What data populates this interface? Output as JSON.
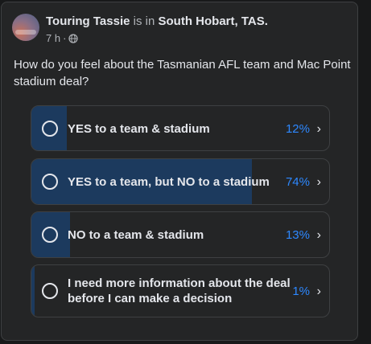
{
  "post": {
    "author": "Touring Tassie",
    "connector": "is in",
    "location": "South Hobart, TAS.",
    "time": "7 h",
    "separator": "·",
    "privacy_icon": "globe-icon",
    "question": "How do you feel about the Tasmanian AFL team and Mac Point stadium deal?"
  },
  "poll": {
    "accent_color": "#2d88ff",
    "fill_color": "#1c3a5e",
    "options": [
      {
        "label": "YES to a team & stadium",
        "percent_text": "12%",
        "percent": 12
      },
      {
        "label": "YES to a team, but NO to a stadium",
        "percent_text": "74%",
        "percent": 74
      },
      {
        "label": "NO to a team & stadium",
        "percent_text": "13%",
        "percent": 13
      },
      {
        "label": "I need more information about the deal before I can make a decision",
        "percent_text": "1%",
        "percent": 1
      }
    ],
    "chevron": "›"
  }
}
